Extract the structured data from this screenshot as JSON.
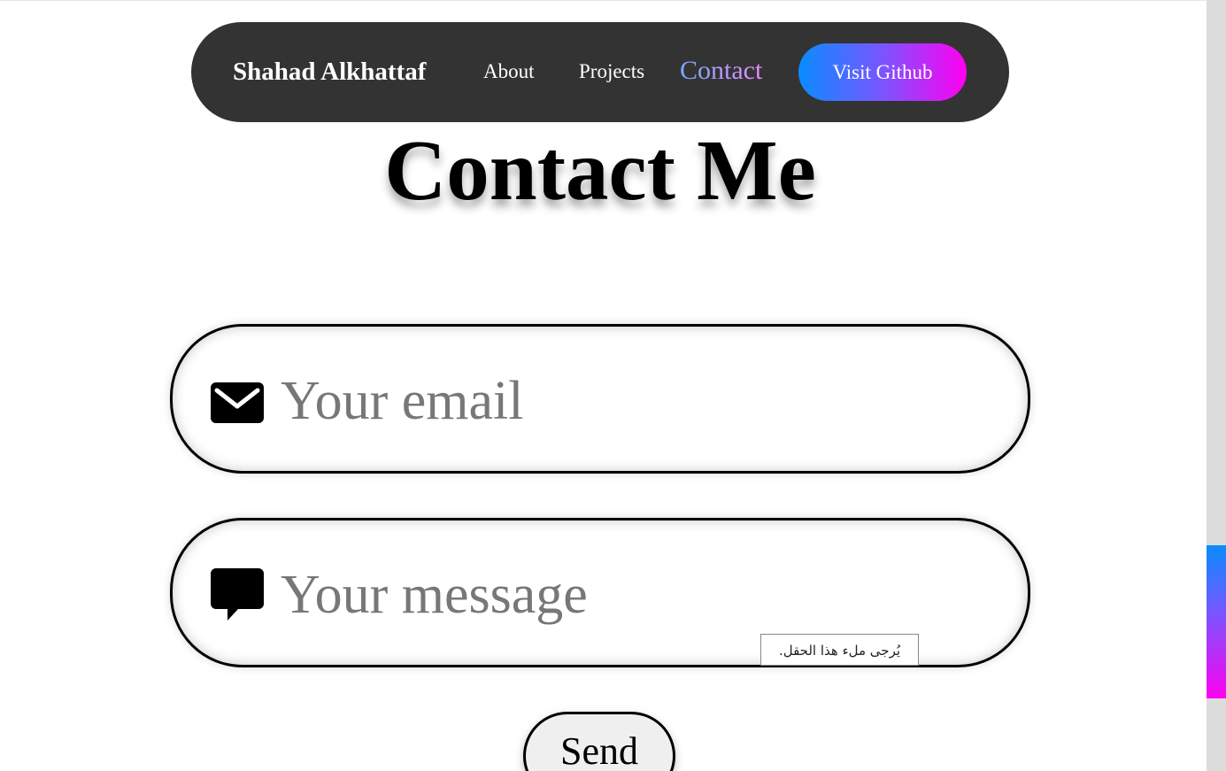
{
  "navbar": {
    "brand": "Shahad Alkhattaf",
    "links": [
      "About",
      "Projects",
      "Contact"
    ],
    "active_link": "Contact",
    "github_label": "Visit Github"
  },
  "page_title": "Contact Me",
  "form": {
    "email_placeholder": "Your email",
    "email_value": "",
    "email_icon": "envelope-icon",
    "message_placeholder": "Your message",
    "message_value": "",
    "message_icon": "chat-bubble-icon",
    "validation_tooltip": "يُرجى ملء هذا الحقل.",
    "send_label": "Send"
  },
  "scrollbar": {
    "thumb_gradient": [
      "#0a8cff",
      "#7a55ff",
      "#ff00f0"
    ]
  },
  "colors": {
    "navbar_bg": "#333333",
    "github_gradient": [
      "#0a8cff",
      "#7a55ff",
      "#ff00f0"
    ],
    "placeholder": "#777777"
  }
}
